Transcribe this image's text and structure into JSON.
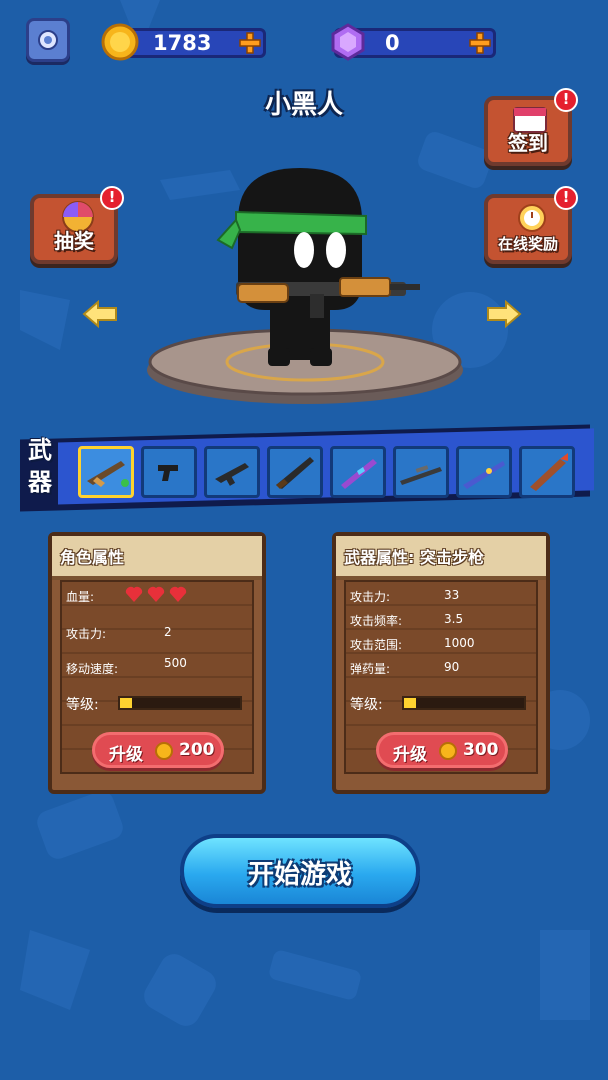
{
  "currency": {
    "coins": "1783",
    "gems": "0",
    "coin_icon": "gold-coin-icon",
    "gem_icon": "purple-gem-icon"
  },
  "character": {
    "name": "小黑人"
  },
  "side_buttons": {
    "checkin_label": "签到",
    "lottery_label": "抽奖",
    "online_reward_label": "在线奖励",
    "badge": "!"
  },
  "weapons": {
    "title_top": "武",
    "title_bottom": "器",
    "slots": [
      "assault-rifle",
      "pistol",
      "smg",
      "shotgun",
      "laser-rifle",
      "sniper-rifle",
      "plasma-rifle",
      "rocket-launcher"
    ],
    "selected_index": 0
  },
  "character_panel": {
    "title": "角色属性",
    "hp_label": "血量:",
    "hp_hearts": 3,
    "attack_label": "攻击力:",
    "attack_value": "2",
    "speed_label": "移动速度:",
    "speed_value": "500",
    "level_label": "等级:",
    "level_fraction": 0.1,
    "upgrade_label": "升级",
    "upgrade_cost": "200"
  },
  "weapon_panel": {
    "title": "武器属性: 突击步枪",
    "attack_label": "攻击力:",
    "attack_value": "33",
    "fire_rate_label": "攻击频率:",
    "fire_rate_value": "3.5",
    "range_label": "攻击范围:",
    "range_value": "1000",
    "ammo_label": "弹药量:",
    "ammo_value": "90",
    "level_label": "等级:",
    "level_fraction": 0.1,
    "upgrade_label": "升级",
    "upgrade_cost": "300"
  },
  "start_button": {
    "label": "开始游戏"
  },
  "colors": {
    "background": "#1d5ea8",
    "start_button": "#2aa9ef",
    "upgrade_button": "#e04b52",
    "level_fill": "#ffd330"
  }
}
